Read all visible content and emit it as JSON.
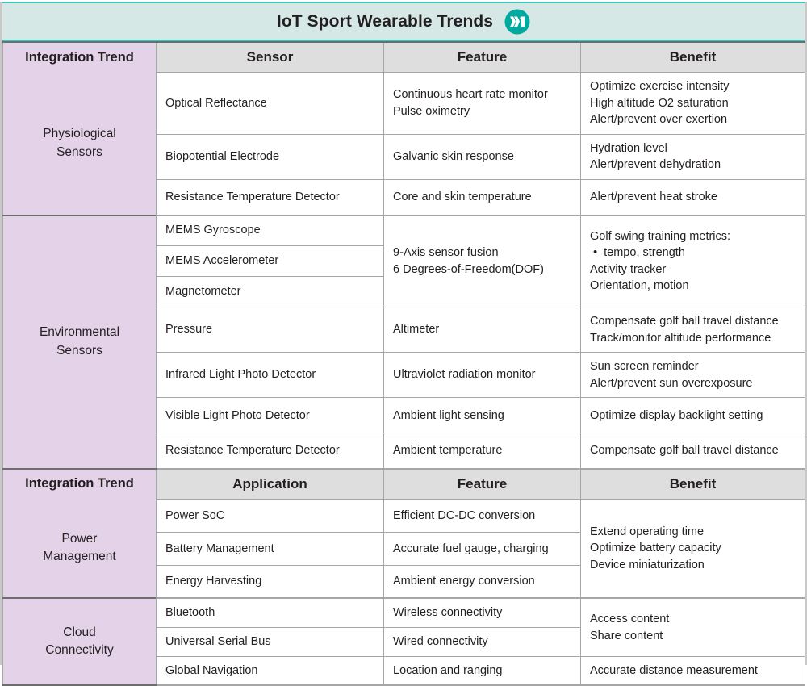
{
  "header": {
    "title": "IoT Sport Wearable Trends",
    "logo_name": "maxim-integrated-logo",
    "banner_bg": "#d5e8e5",
    "banner_border": "#3cc3bb",
    "logo_color": "#00a99d"
  },
  "colors": {
    "trend_column_bg": "#e3d2e8",
    "column_header_bg": "#dedede",
    "grid_line": "#a6a6a6",
    "section_rule": "#6d6d6d",
    "text": "#231f20"
  },
  "section1": {
    "headers": {
      "trend": "Integration Trend",
      "item": "Sensor",
      "feature": "Feature",
      "benefit": "Benefit"
    },
    "groups": [
      {
        "trend": "Physiological\nSensors",
        "trend_line1": "Physiological",
        "trend_line2": "Sensors",
        "rows": [
          {
            "item": "Optical Reflectance",
            "feature": [
              "Continuous heart rate monitor",
              "Pulse oximetry"
            ],
            "benefit": [
              "Optimize exercise intensity",
              "High altitude O2 saturation",
              "Alert/prevent over exertion"
            ]
          },
          {
            "item": "Biopotential Electrode",
            "feature": [
              "Galvanic skin response"
            ],
            "benefit": [
              "Hydration level",
              "Alert/prevent dehydration"
            ]
          },
          {
            "item": "Resistance Temperature Detector",
            "feature": [
              "Core and skin temperature"
            ],
            "benefit": [
              "Alert/prevent heat stroke"
            ]
          }
        ]
      },
      {
        "trend": "Environmental\nSensors",
        "trend_line1": "Environmental",
        "trend_line2": "Sensors",
        "rows": [
          {
            "item": "MEMS Gyroscope",
            "feature": [
              "9-Axis sensor fusion",
              "6 Degrees-of-Freedom(DOF)"
            ],
            "benefit": [
              "Golf swing training metrics:",
              "tempo, strength",
              "Activity tracker",
              "Orientation, motion"
            ]
          },
          {
            "item": "MEMS Accelerometer"
          },
          {
            "item": "Magnetometer"
          },
          {
            "item": "Pressure",
            "feature": [
              "Altimeter"
            ],
            "benefit": [
              "Compensate golf ball travel distance",
              "Track/monitor altitude performance"
            ]
          },
          {
            "item": "Infrared Light Photo Detector",
            "feature": [
              "Ultraviolet radiation monitor"
            ],
            "benefit": [
              "Sun screen reminder",
              "Alert/prevent sun overexposure"
            ]
          },
          {
            "item": "Visible Light Photo Detector",
            "feature": [
              "Ambient light sensing"
            ],
            "benefit": [
              "Optimize display backlight setting"
            ]
          },
          {
            "item": "Resistance Temperature Detector",
            "feature": [
              "Ambient temperature"
            ],
            "benefit": [
              "Compensate golf ball travel distance"
            ]
          }
        ]
      }
    ]
  },
  "section2": {
    "headers": {
      "trend": "Integration Trend",
      "item": "Application",
      "feature": "Feature",
      "benefit": "Benefit"
    },
    "groups": [
      {
        "trend_line1": "Power",
        "trend_line2": "Management",
        "benefit": [
          "Extend operating time",
          "Optimize battery capacity",
          "Device miniaturization"
        ],
        "rows": [
          {
            "item": "Power SoC",
            "feature": [
              "Efficient DC-DC conversion"
            ]
          },
          {
            "item": "Battery Management",
            "feature": [
              "Accurate fuel gauge, charging"
            ]
          },
          {
            "item": "Energy Harvesting",
            "feature": [
              "Ambient energy conversion"
            ]
          }
        ]
      },
      {
        "trend_line1": "Cloud",
        "trend_line2": "Connectivity",
        "benefit": [
          "Access content",
          "Share content"
        ],
        "rows": [
          {
            "item": "Bluetooth",
            "feature": [
              "Wireless connectivity"
            ]
          },
          {
            "item": "Universal Serial Bus",
            "feature": [
              "Wired connectivity"
            ]
          },
          {
            "item": "Global Navigation",
            "feature": [
              "Location and ranging"
            ],
            "benefit": [
              "Accurate distance measurement"
            ]
          }
        ]
      }
    ]
  }
}
